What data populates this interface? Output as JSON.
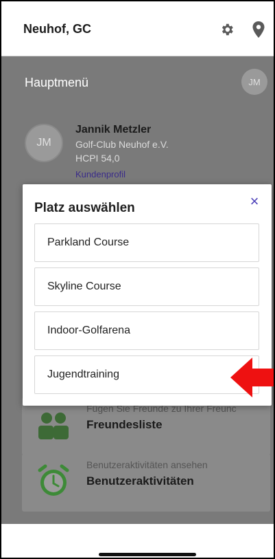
{
  "header": {
    "title": "Neuhof, GC",
    "settings_icon": "gear-icon",
    "location_icon": "location-pin-icon"
  },
  "main": {
    "section_title": "Hauptmenü",
    "small_avatar_initials": "JM",
    "profile": {
      "initials": "JM",
      "name": "Jannik Metzler",
      "club": "Golf-Club Neuhof e.V.",
      "hcpi": "HCPI 54,0",
      "link": "Kundenprofil"
    },
    "cards": [
      {
        "subtitle": "Fügen Sie Freunde zu Ihrer Freunc",
        "title": "Freundesliste",
        "icon": "friends-icon"
      },
      {
        "subtitle": "Benutzeraktivitäten ansehen",
        "title": "Benutzeraktivitäten",
        "icon": "alarm-clock-icon"
      }
    ]
  },
  "dialog": {
    "title": "Platz auswählen",
    "close_icon": "close-icon",
    "options": [
      "Parkland Course",
      "Skyline Course",
      "Indoor-Golfarena",
      "Jugendtraining"
    ]
  },
  "annotation": {
    "arrow_icon": "red-arrow-left-icon",
    "arrow_color": "#ee1111"
  },
  "colors": {
    "accent": "#4b3fb8",
    "overlay": "#7a7a7a",
    "card_icon_green": "#3d8a37"
  }
}
